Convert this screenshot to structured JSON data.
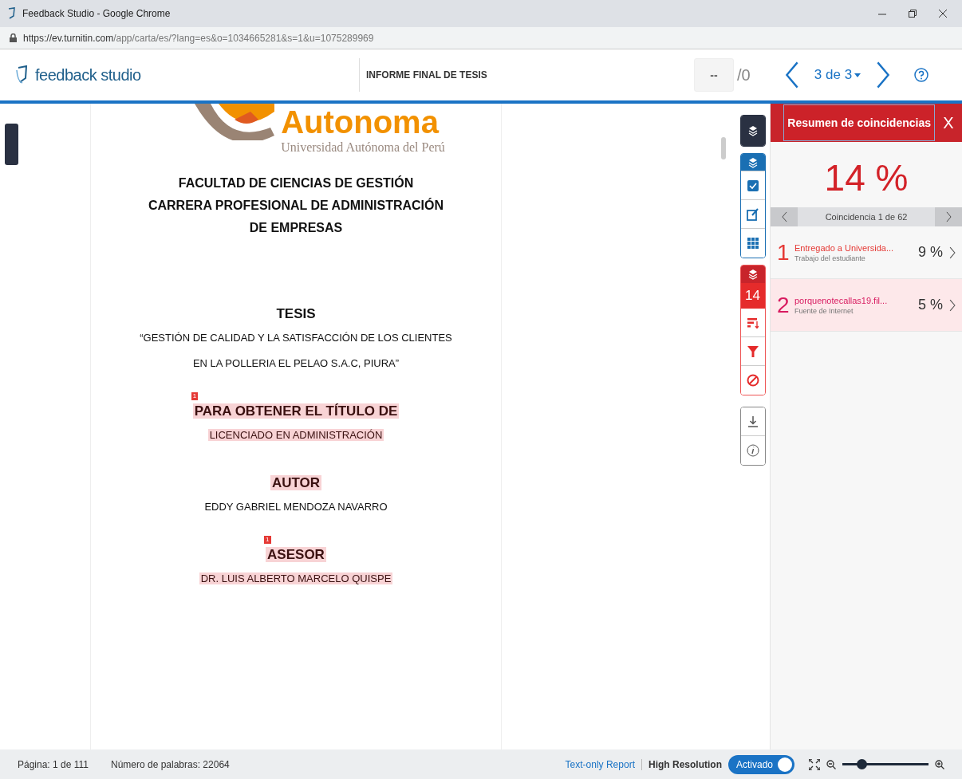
{
  "window": {
    "title": "Feedback Studio - Google Chrome",
    "url_host": "https://ev.turnitin.com",
    "url_path": "/app/carta/es/?lang=es&o=1034665281&s=1&u=1075289969"
  },
  "header": {
    "logo_text": "feedback studio",
    "document_title": "INFORME FINAL DE TESIS",
    "page_input": "--",
    "page_total": "/0",
    "nav_label": "3 de 3"
  },
  "document": {
    "logo_name": "Autonoma",
    "logo_subtitle": "Universidad Autónoma del Perú",
    "blocks": [
      {
        "kind": "heading",
        "text": "FACULTAD DE CIENCIAS DE GESTIÓN",
        "highlighted": false
      },
      {
        "kind": "heading",
        "text": "CARRERA PROFESIONAL DE ADMINISTRACIÓN",
        "highlighted": false
      },
      {
        "kind": "heading",
        "text": "DE EMPRESAS",
        "highlighted": false
      },
      {
        "kind": "gap"
      },
      {
        "kind": "title",
        "text": "TESIS",
        "highlighted": false
      },
      {
        "kind": "line",
        "text": "“GESTIÓN DE CALIDAD Y LA SATISFACCIÓN DE LOS CLIENTES",
        "highlighted": false
      },
      {
        "kind": "line",
        "text": "EN LA POLLERIA EL PELAO S.A.C, PIURA”",
        "highlighted": false
      },
      {
        "kind": "title",
        "text": "PARA OBTENER EL TÍTULO DE",
        "highlighted": true,
        "match": "1"
      },
      {
        "kind": "line",
        "text": "LICENCIADO EN ADMINISTRACIÓN",
        "highlighted": true
      },
      {
        "kind": "title",
        "text": "AUTOR",
        "highlighted": true
      },
      {
        "kind": "line",
        "text": "EDDY GABRIEL MENDOZA NAVARRO",
        "highlighted": false
      },
      {
        "kind": "title",
        "text": "ASESOR",
        "highlighted": true,
        "match": "1"
      },
      {
        "kind": "line",
        "text": "DR. LUIS ALBERTO MARCELO QUISPE",
        "highlighted": true
      }
    ]
  },
  "toolbar": {
    "match_count": "14"
  },
  "panel": {
    "title": "Resumen de coincidencias",
    "close": "X",
    "percent": "14 %",
    "nav_label": "Coincidencia 1 de 62",
    "matches": [
      {
        "number": "1",
        "source": "Entregado a Universida...",
        "type": "Trabajo del estudiante",
        "percent": "9 %",
        "color": "#e53935",
        "selected": false
      },
      {
        "number": "2",
        "source": "porquenotecallas19.fil...",
        "type": "Fuente de Internet",
        "percent": "5 %",
        "color": "#d81b60",
        "selected": true
      }
    ]
  },
  "status_bar": {
    "page": "Página: 1 de 111",
    "words": "Número de palabras: 22064",
    "report_link": "Text-only Report",
    "resolution_label": "High Resolution",
    "toggle": {
      "label": "Activado",
      "on": true
    },
    "zoom": {
      "level": 0.22
    }
  }
}
